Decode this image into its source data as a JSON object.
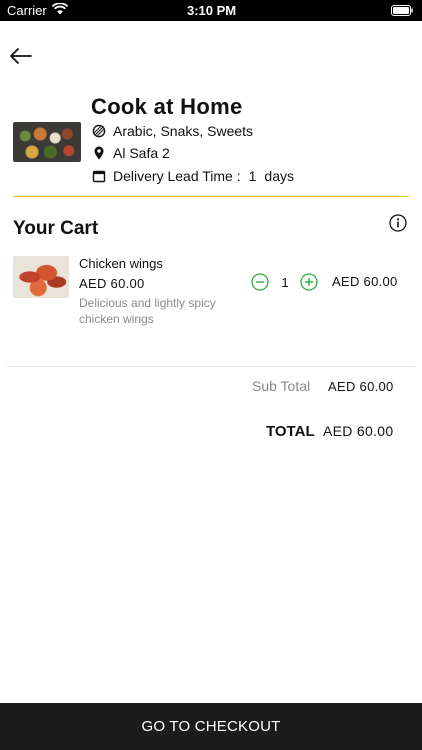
{
  "status_bar": {
    "carrier": "Carrier",
    "time": "3:10 PM"
  },
  "nav": {
    "back_icon": "arrow-left-icon"
  },
  "restaurant": {
    "name": "Cook at Home",
    "cuisine": "Arabic, Snaks, Sweets",
    "location": "Al Safa 2",
    "lead_time_label": "Delivery Lead Time :",
    "lead_time_value": "1",
    "lead_time_unit": "days"
  },
  "cart": {
    "title": "Your Cart",
    "items": [
      {
        "name": "Chicken wings",
        "price": "AED 60.00",
        "description": "Delicious and lightly spicy chicken wings",
        "quantity": "1",
        "total": "AED 60.00"
      }
    ]
  },
  "summary": {
    "subtotal_label": "Sub Total",
    "subtotal_value": "AED 60.00",
    "total_label": "TOTAL",
    "total_value": "AED 60.00"
  },
  "checkout": {
    "label": "GO TO CHECKOUT"
  },
  "colors": {
    "accent_divider": "#f0c419",
    "quantity_button": "#2eaf3e",
    "checkout_background": "#1c1c1c",
    "muted_text": "#8a8a8a"
  }
}
